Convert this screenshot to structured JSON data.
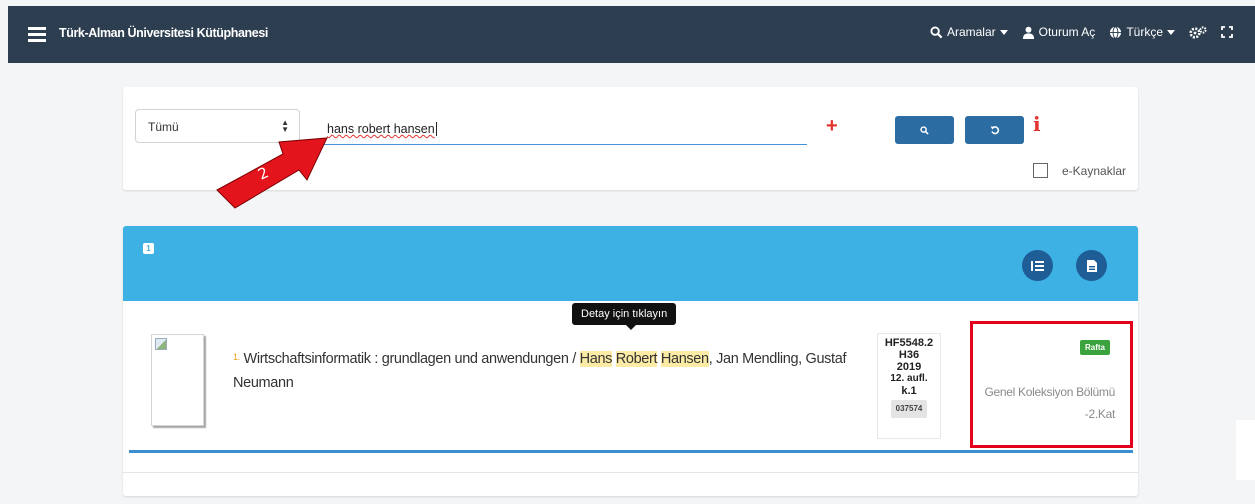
{
  "navbar": {
    "title": "Türk-Alman Üniversitesi Kütüphanesi",
    "searches_label": "Aramalar",
    "login_label": "Oturum Aç",
    "language_label": "Türkçe"
  },
  "search": {
    "scope": "Tümü",
    "query": "hans robert hansen",
    "eresources_label": "e-Kaynaklar",
    "annotation_label": "2"
  },
  "results": {
    "count": "1",
    "tooltip": "Detay için tıklayın",
    "items": [
      {
        "number": "1.",
        "title": "Wirtschaftsinformatik : grundlagen und anwendungen /",
        "author_first": "Hans",
        "author_middle": "Robert",
        "author_last": "Hansen",
        "author_rest": ", Jan Mendling, Gustaf Neumann",
        "callnumber": [
          "HF5548.2",
          "H36",
          "2019",
          "12. aufl.",
          "k.1"
        ],
        "barcode": "037574",
        "status": "Rafta",
        "location_line1": "Genel Koleksiyon Bölümü",
        "location_line2": "-2.Kat"
      }
    ]
  },
  "colors": {
    "navbar": "#2c3e50",
    "header": "#3db1e3",
    "button": "#2b6ca3",
    "highlight_box": "#e3001b",
    "status_badge": "#3aa33d"
  }
}
